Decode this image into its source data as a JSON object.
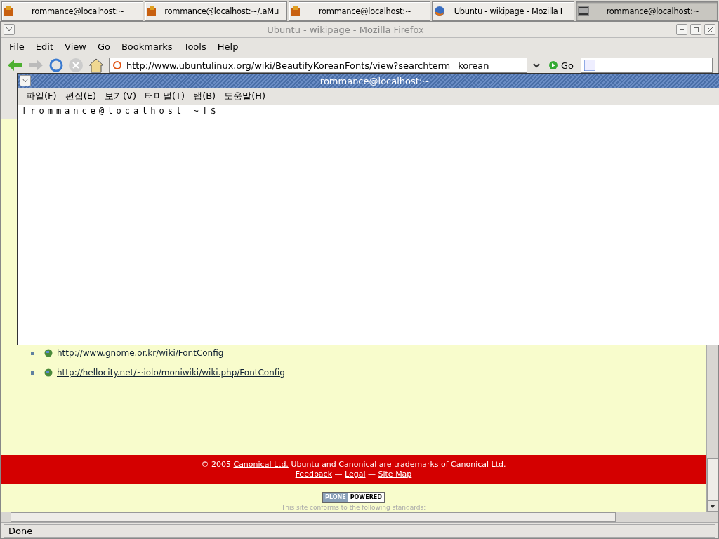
{
  "taskbar": [
    {
      "label": "rommance@localhost:~",
      "kind": "package",
      "selected": false
    },
    {
      "label": "rommance@localhost:~/.aMu",
      "kind": "package",
      "selected": false
    },
    {
      "label": "rommance@localhost:~",
      "kind": "package",
      "selected": false
    },
    {
      "label": "Ubuntu - wikipage - Mozilla F",
      "kind": "browser",
      "selected": false
    },
    {
      "label": "rommance@localhost:~",
      "kind": "terminal",
      "selected": true
    }
  ],
  "browser": {
    "title": "Ubuntu - wikipage - Mozilla Firefox",
    "menu": [
      "File",
      "Edit",
      "View",
      "Go",
      "Bookmarks",
      "Tools",
      "Help"
    ],
    "url": "http://www.ubuntulinux.org/wiki/BeautifyKoreanFonts/view?searchterm=korean",
    "go": "Go",
    "links": [
      "http://www.gnome.or.kr/wiki/FontConfig",
      "http://hellocity.net/~iolo/moniwiki/wiki.php/FontConfig"
    ],
    "footer": {
      "prefix": "© 2005",
      "link": "Canonical Ltd.",
      "suffix": "Ubuntu and Canonical are trademarks of Canonical Ltd.",
      "links": [
        "Feedback",
        "Legal",
        "Site Map"
      ],
      "separator": "—"
    },
    "badge": [
      "PLONE",
      "POWERED"
    ],
    "standards": "This site conforms to the following standards:",
    "status": "Done"
  },
  "terminal": {
    "title": "rommance@localhost:~",
    "menu": [
      "파일(F)",
      "편집(E)",
      "보기(V)",
      "터미널(T)",
      "탭(B)",
      "도움말(H)"
    ],
    "prompt": "[rommance@localhost ~]$"
  }
}
